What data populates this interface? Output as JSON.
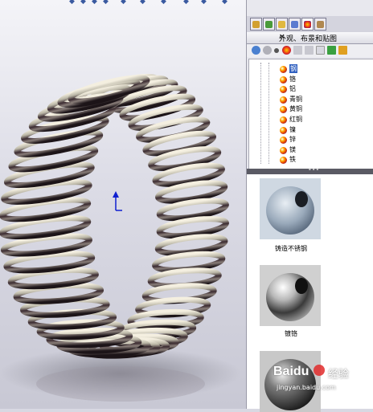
{
  "panel": {
    "title": "外观、布景和贴图",
    "close": "×",
    "materials": [
      "钢",
      "铬",
      "铝",
      "青铜",
      "黄铜",
      "红铜",
      "镍",
      "锌",
      "镁",
      "铁"
    ],
    "selected_material": "钢",
    "splitter": "•••",
    "gallery": [
      {
        "label": "铸造不锈钢"
      },
      {
        "label": "镀铬"
      }
    ]
  },
  "watermark": {
    "brand": "Baidu",
    "cn": "经验",
    "url": "jingyan.baidu.com"
  },
  "colors": {
    "panel_bg": "#e8e8ee",
    "selection": "#3060c0",
    "tree_bg": "#ffffff"
  }
}
